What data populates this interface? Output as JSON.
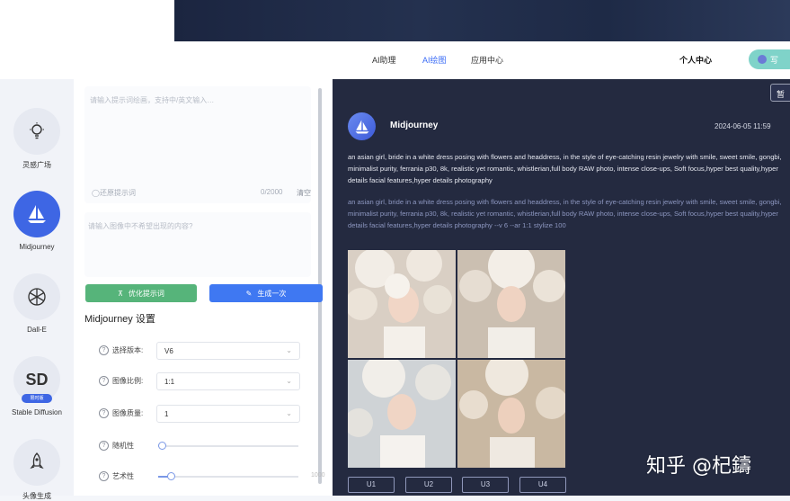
{
  "nav": {
    "items": [
      "AI助理",
      "AI绘图",
      "应用中心"
    ],
    "active_index": 1,
    "user_center": "个人中心",
    "pill_label": "写"
  },
  "sidebar": {
    "items": [
      {
        "label": "灵感广场",
        "icon": "lightbulb-icon"
      },
      {
        "label": "Midjourney",
        "icon": "sailboat-icon",
        "active": true
      },
      {
        "label": "Dall-E",
        "icon": "openai-icon"
      },
      {
        "label": "Stable Diffusion",
        "icon": "sd-icon",
        "glyph": "SD",
        "badge": "限时版"
      },
      {
        "label": "头像生成",
        "icon": "rocket-icon"
      }
    ]
  },
  "settings": {
    "prompt_placeholder": "请输入提示词绘画，支持中/英文输入…",
    "clear_label": "清空",
    "char_count": "0/2000",
    "foot_left": "◯还原提示词",
    "image_placeholder": "请输入图像中不希望出现的内容?",
    "optimize_button": "优化提示词",
    "generate_button": "生成一次",
    "title": "Midjourney 设置",
    "rows": [
      {
        "label": "选择版本:",
        "value": "V6"
      },
      {
        "label": "图像比例:",
        "value": "1:1"
      },
      {
        "label": "图像质量:",
        "value": "1"
      },
      {
        "label": "随机性",
        "value": ""
      },
      {
        "label": "艺术性",
        "value": ""
      }
    ],
    "stylize_max": "1000"
  },
  "result": {
    "corner_label": "暂",
    "model_name": "Midjourney",
    "timestamp": "2024-06-05 11:59",
    "prompt_text": "an asian girl, bride in a white dress posing with flowers and headdress, in the style of eye-catching resin jewelry with smile, sweet smile, gongbi, minimalist purity, ferrania p30, 8k, realistic yet romantic, whistlerian,full body RAW photo, intense close-ups, Soft focus,hyper best quality,hyper details facial features,hyper details photography",
    "prompt_full": "an asian girl, bride in a white dress posing with flowers and headdress, in the style of eye-catching resin jewelry with smile, sweet smile, gongbi, minimalist purity, ferrania p30, 8k, realistic yet romantic, whistlerian,full body RAW photo, intense close-ups, Soft focus,hyper best quality,hyper details facial features,hyper details photography --v 6 --ar 1:1 stylize 100",
    "upscale_buttons": [
      "U1",
      "U2",
      "U3",
      "U4"
    ]
  },
  "watermark": "知乎 @杞鑄",
  "colors": {
    "accent": "#3e66e4",
    "green_button": "#56b47a",
    "blue_button": "#3f78f2",
    "dark_panel": "#242a40"
  }
}
